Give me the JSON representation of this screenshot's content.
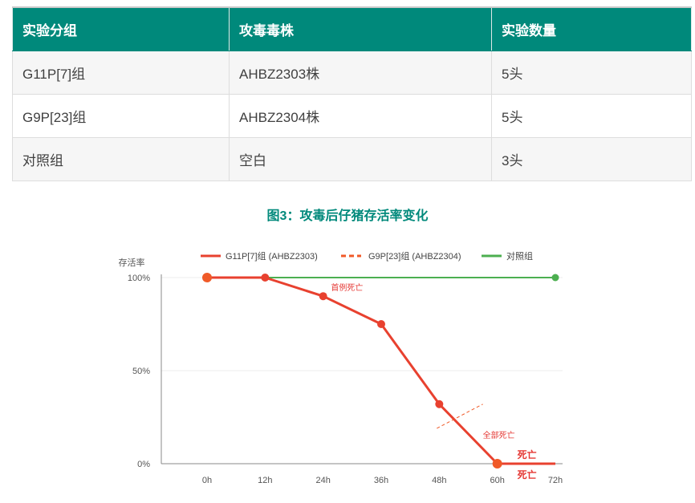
{
  "table": {
    "headers": [
      "实验分组",
      "攻毒毒株",
      "实验数量"
    ],
    "rows": [
      [
        "G11P[7]组",
        "AHBZ2303株",
        "5头"
      ],
      [
        "G9P[23]组",
        "AHBZ2304株",
        "5头"
      ],
      [
        "对照组",
        "空白",
        "3头"
      ]
    ]
  },
  "figure_title": "图3：攻毒后仔猪存活率变化",
  "chart_data": {
    "type": "line",
    "title": "",
    "ylabel": "存活率",
    "xlabel": "",
    "x": [
      "0h",
      "12h",
      "24h",
      "36h",
      "48h",
      "60h",
      "72h"
    ],
    "x_hours": [
      0,
      12,
      24,
      36,
      48,
      60,
      72
    ],
    "y_ticks": [
      "0%",
      "50%",
      "100%"
    ],
    "ylim": [
      0,
      100
    ],
    "grid": "horizontal",
    "legend_position": "top",
    "series": [
      {
        "name": "G11P[7]组 (AHBZ2303)",
        "color": "#e8412f",
        "style": "solid",
        "points": [
          [
            0,
            100
          ],
          [
            12,
            100
          ],
          [
            24,
            90
          ],
          [
            36,
            75
          ],
          [
            48,
            32
          ],
          [
            60,
            0
          ],
          [
            72,
            0
          ]
        ],
        "markers": [
          [
            0,
            100
          ],
          [
            12,
            100
          ],
          [
            24,
            90
          ],
          [
            36,
            75
          ],
          [
            48,
            32
          ],
          [
            60,
            0
          ]
        ]
      },
      {
        "name": "G9P[23]组 (AHBZ2304)",
        "color": "#f05a28",
        "style": "dashed",
        "points": [
          [
            0,
            100
          ],
          [
            12,
            100
          ],
          [
            24,
            90
          ],
          [
            36,
            75
          ],
          [
            48,
            32
          ],
          [
            60,
            0
          ],
          [
            72,
            0
          ]
        ],
        "markers": [
          [
            0,
            100
          ],
          [
            60,
            0
          ]
        ]
      },
      {
        "name": "对照组",
        "color": "#4caf50",
        "style": "solid",
        "points": [
          [
            0,
            100
          ],
          [
            72,
            100
          ]
        ],
        "markers": [
          [
            72,
            100
          ]
        ]
      }
    ],
    "annotations": {
      "first_death": "首例死亡",
      "all_dead": "全部死亡",
      "dead_1": "死亡",
      "dead_2": "死亡"
    }
  }
}
